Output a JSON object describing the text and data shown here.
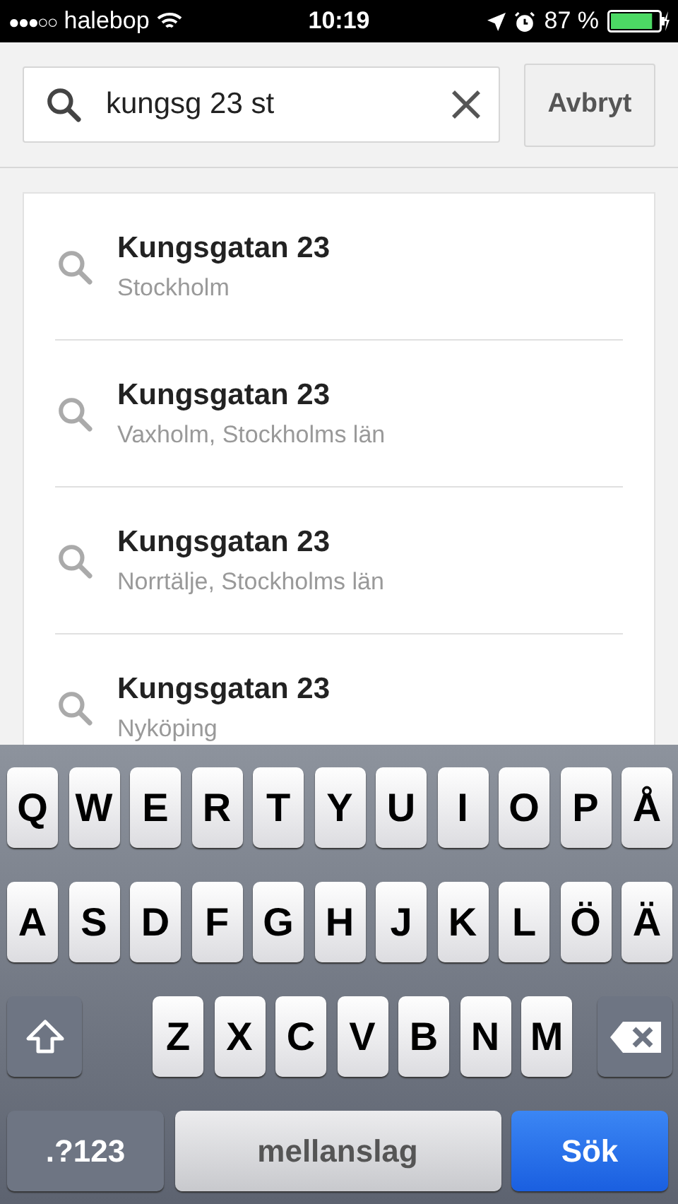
{
  "status_bar": {
    "signal_dots": "●●●○○",
    "carrier": "halebop",
    "time": "10:19",
    "battery_text": "87 %",
    "level": 0.87
  },
  "search": {
    "value": "kungsg 23 st",
    "cancel": "Avbryt"
  },
  "results": [
    {
      "title": "Kungsgatan 23",
      "subtitle": "Stockholm"
    },
    {
      "title": "Kungsgatan 23",
      "subtitle": "Vaxholm, Stockholms län"
    },
    {
      "title": "Kungsgatan 23",
      "subtitle": "Norrtälje, Stockholms län"
    },
    {
      "title": "Kungsgatan 23",
      "subtitle": "Nyköping"
    }
  ],
  "keyboard": {
    "rows": [
      [
        "Q",
        "W",
        "E",
        "R",
        "T",
        "Y",
        "U",
        "I",
        "O",
        "P",
        "Å"
      ],
      [
        "A",
        "S",
        "D",
        "F",
        "G",
        "H",
        "J",
        "K",
        "L",
        "Ö",
        "Ä"
      ],
      [
        "Z",
        "X",
        "C",
        "V",
        "B",
        "N",
        "M"
      ]
    ],
    "numbers": ".?123",
    "space": "mellanslag",
    "action": "Sök"
  }
}
